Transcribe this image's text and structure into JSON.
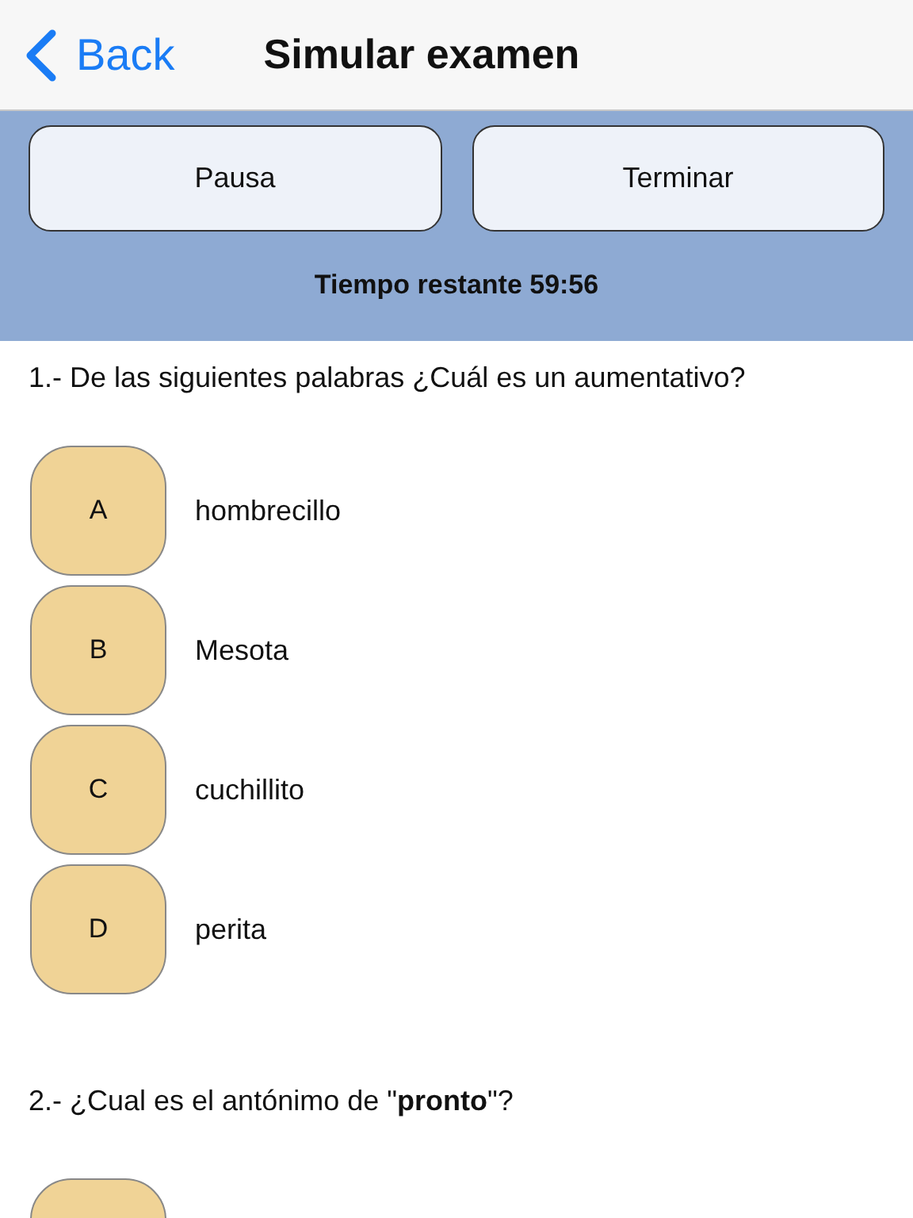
{
  "nav": {
    "back": "Back",
    "title": "Simular examen"
  },
  "controls": {
    "buttons": [
      "Pausa",
      "Terminar"
    ],
    "timer": "Tiempo restante 59:56"
  },
  "questions": [
    {
      "text": "1.- De las siguientes palabras ¿Cuál es un aumentativo?",
      "options": [
        {
          "kind": "answer",
          "letter": "A",
          "text": "hombrecillo"
        },
        {
          "kind": "answer",
          "letter": "B",
          "text": "Mesota"
        },
        {
          "kind": "answer",
          "letter": "C",
          "text": "cuchillito"
        },
        {
          "kind": "answer",
          "letter": "D",
          "text": "perita"
        }
      ]
    },
    {
      "text": "2.- ¿Cual es el antónimo de \"**pronto**\"?",
      "options": [
        {
          "kind": "cut"
        }
      ]
    }
  ]
}
